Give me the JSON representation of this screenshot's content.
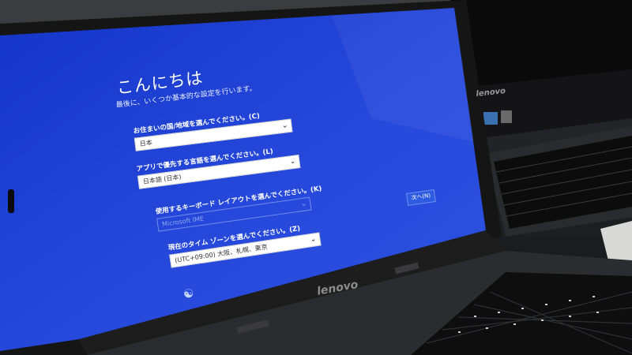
{
  "setup": {
    "title": "こんにちは",
    "subtitle": "最後に、いくつか基本的な設定を行います。",
    "fields": [
      {
        "label": "お住まいの国/地域を選んでください。(C)",
        "value": "日本"
      },
      {
        "label": "アプリで優先する言語を選んでください。(L)",
        "value": "日本語 (日本)"
      },
      {
        "label": "使用するキーボード レイアウトを選んでください。(K)",
        "value": "Microsoft IME"
      },
      {
        "label": "現在のタイム ゾーンを選んでください。(Z)",
        "value": "(UTC+09:00) 大阪、札幌、東京"
      }
    ],
    "next_label": "次へ(N)"
  },
  "branding": {
    "front_laptop_logo": "lenovo",
    "back_monitor_logo": "lenovo"
  },
  "icons": {
    "chevron": "chevron-down-icon",
    "ease_of_access": "ease-of-access-icon"
  },
  "colors": {
    "screen_blue": "#1f3fd2",
    "bezel": "#1a1a1a",
    "button_blue": "#2d5ce0"
  }
}
